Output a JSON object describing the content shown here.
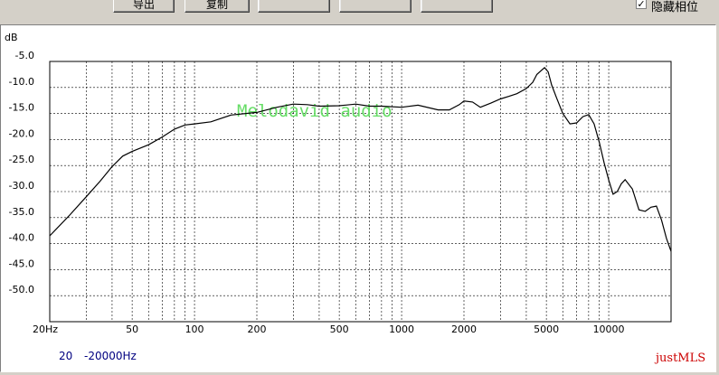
{
  "toolbar": {
    "export_label": "导出",
    "copy_label": "复制",
    "hide_phase_label": "隐藏相位",
    "hide_phase_checked": true,
    "check_mark": "✓"
  },
  "range_text": {
    "start": "20",
    "end": "-20000Hz"
  },
  "brand": "justMLS",
  "colors": {
    "curve": "#000000",
    "grid": "#000000",
    "watermark": "#66dd66",
    "brand": "#cc0000",
    "range_text": "#000080"
  },
  "chart_data": {
    "type": "line",
    "title": "",
    "ylabel": "dB",
    "xlabel": "",
    "x_scale": "log",
    "xlim": [
      20,
      20000
    ],
    "ylim": [
      -55,
      -5
    ],
    "y_ticks": [
      -5.0,
      -10.0,
      -15.0,
      -20.0,
      -25.0,
      -30.0,
      -35.0,
      -40.0,
      -45.0,
      -50.0
    ],
    "y_tick_labels": [
      "-5.0",
      "-10.0",
      "-15.0",
      "-20.0",
      "-25.0",
      "-30.0",
      "-35.0",
      "-40.0",
      "-45.0",
      "-50.0"
    ],
    "x_ticks": [
      20,
      50,
      100,
      200,
      500,
      1000,
      2000,
      5000,
      10000
    ],
    "x_tick_labels": [
      "20Hz",
      "50",
      "100",
      "200",
      "500",
      "1000",
      "2000",
      "5000",
      "10000"
    ],
    "grid": true,
    "watermark": "Melodavid audio",
    "series": [
      {
        "x": [
          20,
          25,
          30,
          35,
          40,
          45,
          50,
          60,
          70,
          80,
          90,
          100,
          120,
          150,
          200,
          250,
          300,
          350,
          400,
          500,
          600,
          700,
          800,
          1000,
          1200,
          1500,
          1700,
          1900,
          2000,
          2200,
          2400,
          2700,
          3000,
          3300,
          3600,
          4000,
          4300,
          4500,
          4700,
          4900,
          5100,
          5300,
          5600,
          6000,
          6500,
          7000,
          7500,
          8000,
          8500,
          9000,
          9500,
          10000,
          10500,
          11000,
          11500,
          12000,
          13000,
          14000,
          15000,
          16000,
          17000,
          18000,
          19000,
          20000
        ],
        "y": [
          -38.5,
          -34.5,
          -31.0,
          -28.0,
          -25.2,
          -23.2,
          -22.3,
          -21.0,
          -19.5,
          -18.0,
          -17.2,
          -17.0,
          -16.6,
          -15.3,
          -14.8,
          -13.8,
          -13.2,
          -13.3,
          -13.6,
          -13.5,
          -13.2,
          -13.6,
          -13.6,
          -13.8,
          -13.4,
          -14.3,
          -14.3,
          -13.3,
          -12.6,
          -12.8,
          -13.8,
          -13.0,
          -12.2,
          -11.7,
          -11.2,
          -10.2,
          -9.0,
          -7.5,
          -6.8,
          -6.2,
          -7.0,
          -9.5,
          -12.0,
          -15.0,
          -17.0,
          -16.8,
          -15.6,
          -15.2,
          -17.0,
          -20.5,
          -24.5,
          -27.8,
          -30.5,
          -30.0,
          -28.5,
          -27.7,
          -29.5,
          -33.5,
          -33.8,
          -33.0,
          -32.8,
          -35.5,
          -39.0,
          -41.5
        ]
      }
    ]
  }
}
